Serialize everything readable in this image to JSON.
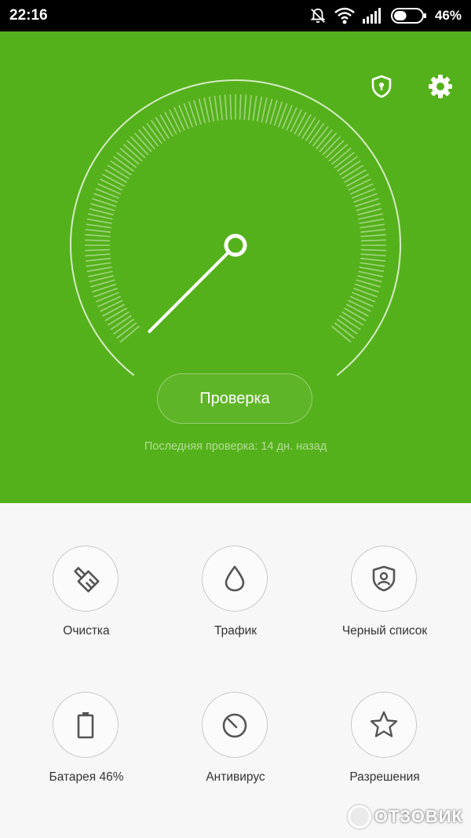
{
  "status_bar": {
    "time": "22:16",
    "battery_text": "46%",
    "battery_level": 0.46,
    "icons": [
      "mute-bell-icon",
      "wifi-icon",
      "signal-icon",
      "battery-icon"
    ]
  },
  "header": {
    "icons": [
      "security-shield-icon",
      "settings-gear-icon"
    ],
    "accent_color": "#55b11b"
  },
  "gauge": {
    "needle_angle_deg": 45
  },
  "scan": {
    "button_label": "Проверка",
    "last_check_text": "Последняя проверка: 14 дн. назад"
  },
  "tools": [
    {
      "label": "Очистка",
      "icon": "broom-icon"
    },
    {
      "label": "Трафик",
      "icon": "drop-icon"
    },
    {
      "label": "Черный список",
      "icon": "shield-user-icon"
    },
    {
      "label": "Батарея 46%",
      "icon": "battery-icon"
    },
    {
      "label": "Антивирус",
      "icon": "antivirus-dial-icon"
    },
    {
      "label": "Разрешения",
      "icon": "star-icon"
    }
  ],
  "watermark": {
    "text": "ОТЗОВИК"
  }
}
